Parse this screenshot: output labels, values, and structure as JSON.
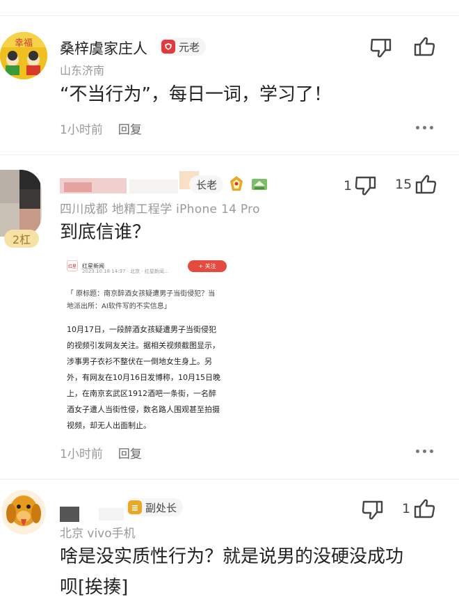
{
  "comments": [
    {
      "username": "桑梓虞家庄人",
      "badge": "元老",
      "location": "山东济南",
      "content": "“不当行为”，每日一词，学习了！",
      "time": "1小时前",
      "reply": "回复",
      "dislikes": "",
      "likes": ""
    },
    {
      "username": "",
      "badge": "长老",
      "floor": "2杠",
      "location": "四川成都  地精工程学  iPhone 14 Pro",
      "content": "到底信谁？",
      "time": "1小时前",
      "reply": "回复",
      "dislikes": "1",
      "likes": "15",
      "embed": {
        "source": "红星新闻",
        "time": "2023.10.18 14:37 · 北京 · 红星新闻...",
        "follow": "+ 关注",
        "quote": "「 原标题：南京醉酒女孩疑遭男子当街侵犯？当地派出所：AI软件写的不实信息」",
        "body": "10月17日，一段醉酒女孩疑遭男子当街侵犯的视频引发网友关注。据相关视频截图显示，涉事男子衣衫不整伏在一倒地女生身上。另外，有网友在10月16日发博称，10月15日晚上，在南京玄武区1912酒吧一条街，一名醉酒女子遭人当街性侵，数名路人围观甚至拍摄视频，却无人出面制止。"
      }
    },
    {
      "username": "",
      "badge": "副处长",
      "location": "北京  vivo手机",
      "content_line1": "啥是没实质性行为？就是说男的没硬没成功",
      "content_line2": "呗[挨揍]",
      "dislikes": "",
      "likes": "1"
    }
  ],
  "colors": {
    "badge_red": "#e4393c",
    "badge_gold": "#e9a825",
    "follow_red": "#e54a3f",
    "muted": "#999999"
  },
  "icons": [
    "thumbs-up-icon",
    "thumbs-down-icon",
    "more-icon",
    "shield-icon",
    "crown-icon"
  ]
}
